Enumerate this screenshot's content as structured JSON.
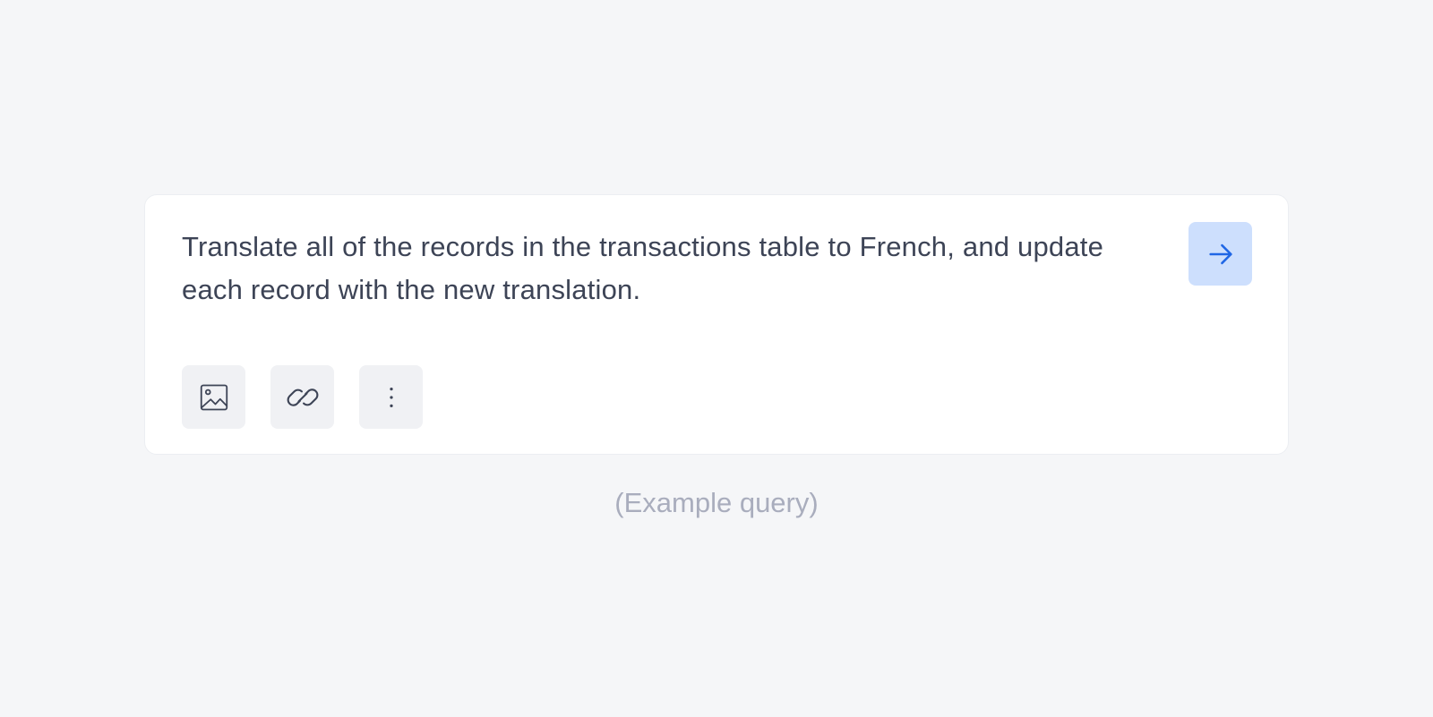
{
  "composer": {
    "query_text": "Translate all of the records in the transactions table to French, and update each record with the new translation.",
    "send_icon": "arrow-right-icon",
    "tools": [
      {
        "icon": "image-icon"
      },
      {
        "icon": "link-icon"
      },
      {
        "icon": "more-vertical-icon"
      }
    ]
  },
  "caption": "(Example query)",
  "colors": {
    "background": "#f5f6f8",
    "card": "#ffffff",
    "text": "#3d4456",
    "send_bg": "#cddffd",
    "send_icon": "#1f66e5",
    "tool_bg": "#f0f1f4",
    "caption": "#a9adbd"
  }
}
